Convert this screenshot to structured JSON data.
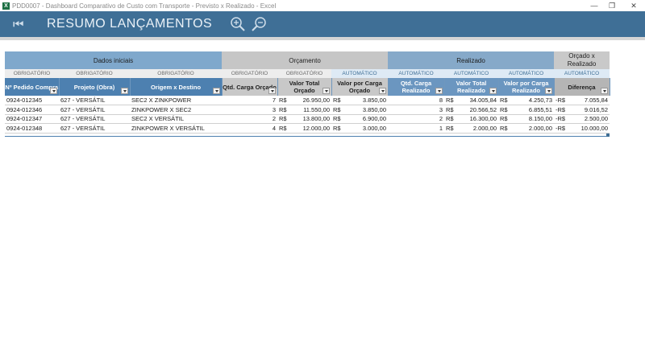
{
  "window": {
    "title": "PDD0007 - Dashboard Comparativo de Custo com Transporte - Previsto x Realizado - Excel",
    "minimize": "—",
    "restore": "❐",
    "close": "✕"
  },
  "ribbon": {
    "back_icon": "⏮",
    "title": "RESUMO LANÇAMENTOS",
    "zoom_in_icon": "zoom-in-icon",
    "zoom_out_icon": "zoom-out-icon"
  },
  "table": {
    "groups": [
      "Dados iniciais",
      "Orçamento",
      "Realizado",
      "Orçado x Realizado"
    ],
    "requirements": [
      "OBRIGATÓRIO",
      "OBRIGATÓRIO",
      "OBRIGATÓRIO",
      "OBRIGATÓRIO",
      "OBRIGATÓRIO",
      "AUTOMÁTICO",
      "AUTOMÁTICO",
      "AUTOMÁTICO",
      "AUTOMÁTICO",
      "AUTOMÁTICO"
    ],
    "headers": [
      "Nº Pedido Compra",
      "Projeto (Obra)",
      "Origem x Destino",
      "Qtd. Carga Orçado",
      "Valor Total Orçado",
      "Valor por Carga Orçado",
      "Qtd. Carga Realizado",
      "Valor Total Realizado",
      "Valor por Carga Realizado",
      "Diferença"
    ],
    "currency": "R$",
    "neg_prefix": "-R$",
    "rows": [
      {
        "pedido": "0924-012345",
        "projeto": "627 - VERSÁTIL",
        "origem": "SEC2 X ZINKPOWER",
        "qtd_orc": "7",
        "vt_orc": "26.950,00",
        "vc_orc": "3.850,00",
        "qtd_real": "8",
        "vt_real": "34.005,84",
        "vc_real": "4.250,73",
        "dif": "7.055,84"
      },
      {
        "pedido": "0924-012346",
        "projeto": "627 - VERSÁTIL",
        "origem": "ZINKPOWER X SEC2",
        "qtd_orc": "3",
        "vt_orc": "11.550,00",
        "vc_orc": "3.850,00",
        "qtd_real": "3",
        "vt_real": "20.566,52",
        "vc_real": "6.855,51",
        "dif": "9.016,52"
      },
      {
        "pedido": "0924-012347",
        "projeto": "627 - VERSÁTIL",
        "origem": "SEC2 X VERSÁTIL",
        "qtd_orc": "2",
        "vt_orc": "13.800,00",
        "vc_orc": "6.900,00",
        "qtd_real": "2",
        "vt_real": "16.300,00",
        "vc_real": "8.150,00",
        "dif": "2.500,00"
      },
      {
        "pedido": "0924-012348",
        "projeto": "627 - VERSÁTIL",
        "origem": "ZINKPOWER X VERSÁTIL",
        "qtd_orc": "4",
        "vt_orc": "12.000,00",
        "vc_orc": "3.000,00",
        "qtd_real": "1",
        "vt_real": "2.000,00",
        "vc_real": "2.000,00",
        "dif": "10.000,00"
      }
    ]
  }
}
